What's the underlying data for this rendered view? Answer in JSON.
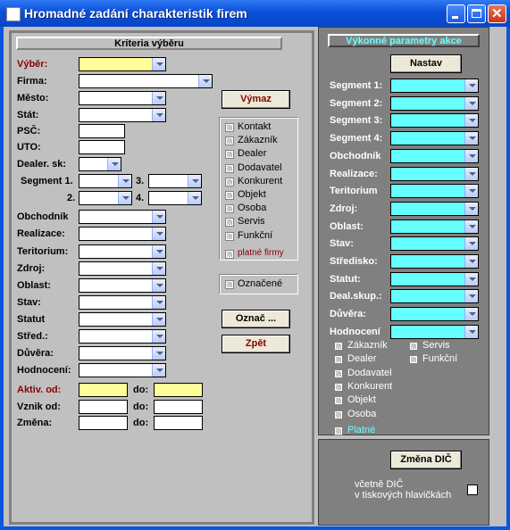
{
  "window": {
    "title": "Hromadné zadání charakteristik firem"
  },
  "left": {
    "header": "Kriteria výběru",
    "labels": {
      "vyber": "Výběr:",
      "firma": "Firma:",
      "mesto": "Město:",
      "stat": "Stát:",
      "psc": "PSČ:",
      "uto": "UTO:",
      "dealer_sk": "Dealer. sk:",
      "segment1": "Segment 1.",
      "seg2": "2.",
      "seg3": "3.",
      "seg4": "4.",
      "obchodnik": "Obchodník",
      "realizace": "Realizace:",
      "teritorium": "Teritorium:",
      "zdroj": "Zdroj:",
      "oblast": "Oblast:",
      "stav": "Stav:",
      "statut": "Statut",
      "stred": "Střed.:",
      "duvera": "Důvěra:",
      "hodnoceni": "Hodnocení:",
      "aktiv_od": "Aktiv. od:",
      "vznik_od": "Vznik od:",
      "zmena": "Změna:",
      "do1": "do:",
      "do2": "do:",
      "do3": "do:"
    },
    "buttons": {
      "vymaz": "Výmaz",
      "oznac": "Označ ...",
      "zpet": "Zpět"
    },
    "checks": [
      "Kontakt",
      "Zákazník",
      "Dealer",
      "Dodavatel",
      "Konkurent",
      "Objekt",
      "Osoba",
      "Servis",
      "Funkční"
    ],
    "platne": "platné firmy",
    "oznacene": "Označené"
  },
  "right": {
    "header": "Výkonné parametry akce",
    "nastav": "Nastav",
    "labels": [
      "Segment 1:",
      "Segment 2:",
      "Segment 3:",
      "Segment 4:",
      "Obchodník",
      "Realizace:",
      "Teritorium",
      "Zdroj:",
      "Oblast:",
      "Stav:",
      "Středisko:",
      "Statut:",
      "Deal.skup.:",
      "Důvěra:",
      "Hodnocení"
    ],
    "checks_left": [
      "Zákazník",
      "Dealer",
      "Dodavatel",
      "Konkurent",
      "Objekt",
      "Osoba"
    ],
    "checks_right": [
      "Servis",
      "Funkční"
    ],
    "platne": "Platné",
    "zmena_dic": "Změna DIČ",
    "vcetne_line1": "včetně DIČ",
    "vcetne_line2": "v tiskových hlavičkách"
  },
  "colors": {
    "title_blue": "#0B56E0",
    "field_yellow": "#FFFF99",
    "field_cyan": "#66FFFF",
    "label_red": "#8B0000"
  }
}
